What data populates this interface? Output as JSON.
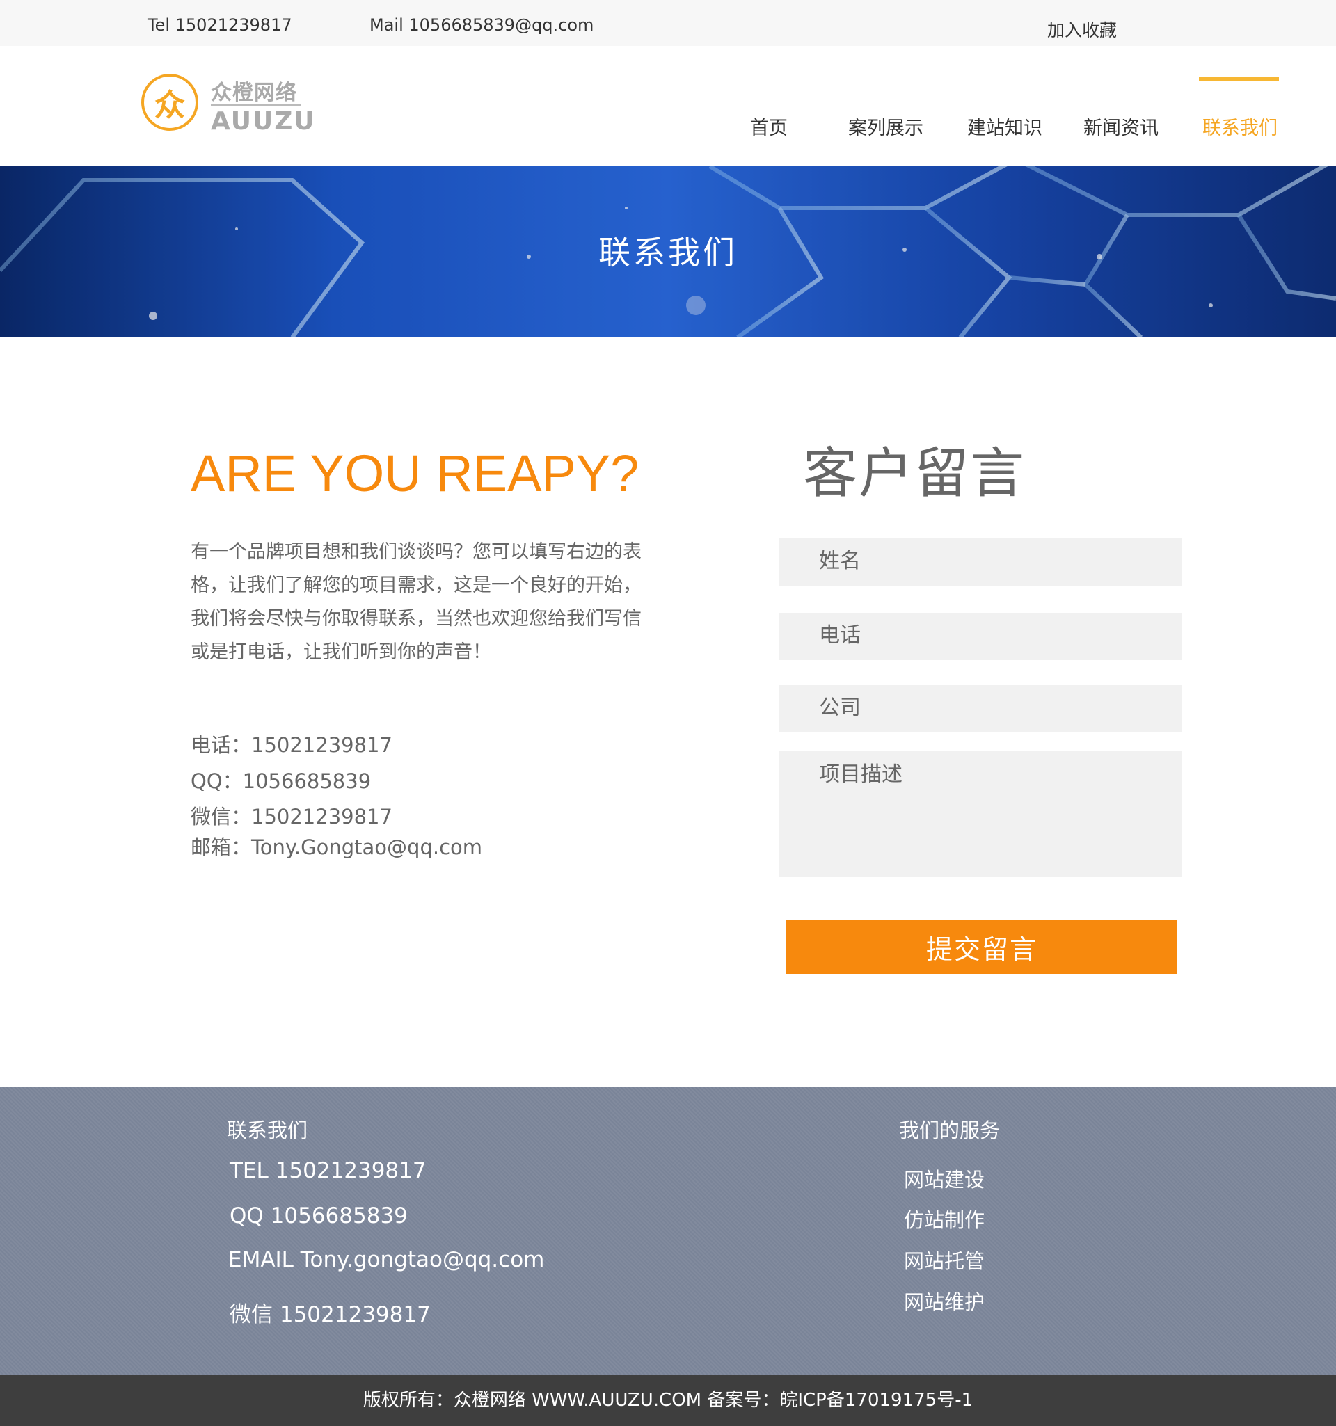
{
  "topbar": {
    "tel": "Tel 15021239817",
    "mail": "Mail 1056685839@qq.com",
    "favorite": "加入收藏"
  },
  "logo": {
    "mark": "众",
    "name_cn": "众橙网络",
    "name_en": "AUUZU"
  },
  "nav": {
    "items": [
      "首页",
      "案列展示",
      "建站知识",
      "新闻资讯",
      "联系我们"
    ],
    "active_index": 4
  },
  "banner": {
    "title": "联系我们"
  },
  "main": {
    "headline": "ARE YOU REAPY?",
    "intro": "有一个品牌项目想和我们谈谈吗？您可以填写右边的表格，让我们了解您的项目需求，这是一个良好的开始，我们将会尽快与你取得联系，当然也欢迎您给我们写信或是打电话，让我们听到你的声音！",
    "contact": {
      "phone": "电话：15021239817",
      "qq": "QQ：1056685839",
      "wechat": "微信：15021239817",
      "email": "邮箱：Tony.Gongtao@qq.com"
    }
  },
  "form": {
    "title": "客户留言",
    "name_placeholder": "姓名",
    "phone_placeholder": "电话",
    "company_placeholder": "公司",
    "desc_placeholder": "项目描述",
    "submit_label": "提交留言"
  },
  "footer": {
    "contact_title": "联系我们",
    "tel": "TEL 15021239817",
    "qq": "QQ 1056685839",
    "email": "EMAIL Tony.gongtao@qq.com",
    "wechat": "微信 15021239817",
    "services_title": "我们的服务",
    "services": [
      "网站建设",
      "仿站制作",
      "网站托管",
      "网站维护"
    ],
    "copyright": "版权所有：众橙网络 WWW.AUUZU.COM      备案号：皖ICP备17019175号-1"
  },
  "colors": {
    "accent": "#f7890d",
    "nav_active": "#f5a623",
    "footer_bg": "#7a8498",
    "copyright_bg": "#3e3e3e"
  }
}
